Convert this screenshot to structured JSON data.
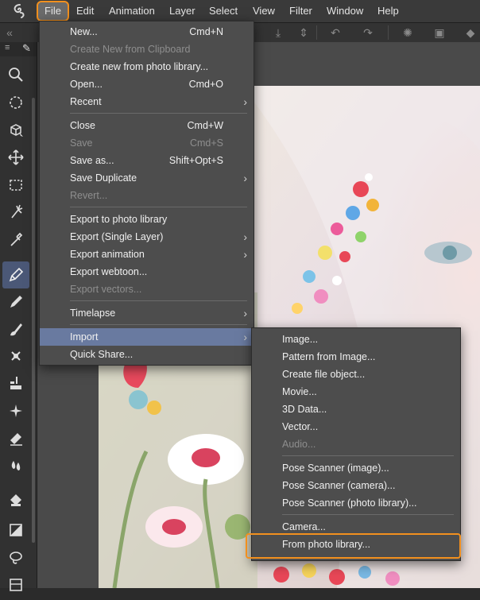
{
  "menubar": {
    "items": [
      "File",
      "Edit",
      "Animation",
      "Layer",
      "Select",
      "View",
      "Filter",
      "Window",
      "Help"
    ]
  },
  "file_menu": {
    "items": [
      {
        "label": "New...",
        "shortcut": "Cmd+N",
        "enabled": true
      },
      {
        "label": "Create New from Clipboard",
        "shortcut": "",
        "enabled": false
      },
      {
        "label": "Create new from photo library...",
        "shortcut": "",
        "enabled": true
      },
      {
        "label": "Open...",
        "shortcut": "Cmd+O",
        "enabled": true
      },
      {
        "label": "Recent",
        "shortcut": "",
        "enabled": true,
        "submenu": true
      },
      {
        "label": "Close",
        "shortcut": "Cmd+W",
        "enabled": true
      },
      {
        "label": "Save",
        "shortcut": "Cmd+S",
        "enabled": false
      },
      {
        "label": "Save as...",
        "shortcut": "Shift+Opt+S",
        "enabled": true
      },
      {
        "label": "Save Duplicate",
        "shortcut": "",
        "enabled": true,
        "submenu": true
      },
      {
        "label": "Revert...",
        "shortcut": "",
        "enabled": false
      },
      {
        "label": "Export to photo library",
        "shortcut": "",
        "enabled": true
      },
      {
        "label": "Export (Single Layer)",
        "shortcut": "",
        "enabled": true,
        "submenu": true
      },
      {
        "label": "Export animation",
        "shortcut": "",
        "enabled": true,
        "submenu": true
      },
      {
        "label": "Export webtoon...",
        "shortcut": "",
        "enabled": true
      },
      {
        "label": "Export vectors...",
        "shortcut": "",
        "enabled": false
      },
      {
        "label": "Timelapse",
        "shortcut": "",
        "enabled": true,
        "submenu": true
      },
      {
        "label": "Import",
        "shortcut": "",
        "enabled": true,
        "submenu": true,
        "highlighted": true
      },
      {
        "label": "Quick Share...",
        "shortcut": "",
        "enabled": true
      }
    ]
  },
  "import_menu": {
    "items": [
      {
        "label": "Image...",
        "enabled": true
      },
      {
        "label": "Pattern from Image...",
        "enabled": true
      },
      {
        "label": "Create file object...",
        "enabled": true
      },
      {
        "label": "Movie...",
        "enabled": true
      },
      {
        "label": "3D Data...",
        "enabled": true
      },
      {
        "label": "Vector...",
        "enabled": true
      },
      {
        "label": "Audio...",
        "enabled": false
      },
      {
        "label": "Pose Scanner (image)...",
        "enabled": true
      },
      {
        "label": "Pose Scanner (camera)...",
        "enabled": true
      },
      {
        "label": "Pose Scanner (photo library)...",
        "enabled": true
      },
      {
        "label": "Camera...",
        "enabled": true
      },
      {
        "label": "From photo library...",
        "enabled": true
      }
    ]
  },
  "colors": {
    "accent_outline": "#f2901e",
    "menu_highlight": "#697aa0",
    "menu_bg": "#4d4d4d"
  },
  "tools": [
    "zoom-icon",
    "move-icon",
    "object-icon",
    "move-layer-icon",
    "selection-icon",
    "auto-select-icon",
    "eyedropper-icon",
    "pen-icon",
    "pencil-icon",
    "brush-icon",
    "airbrush-icon",
    "decoration-icon",
    "blend-icon",
    "eraser-icon",
    "fill-icon",
    "gradient-icon",
    "lasso-fill-icon"
  ]
}
